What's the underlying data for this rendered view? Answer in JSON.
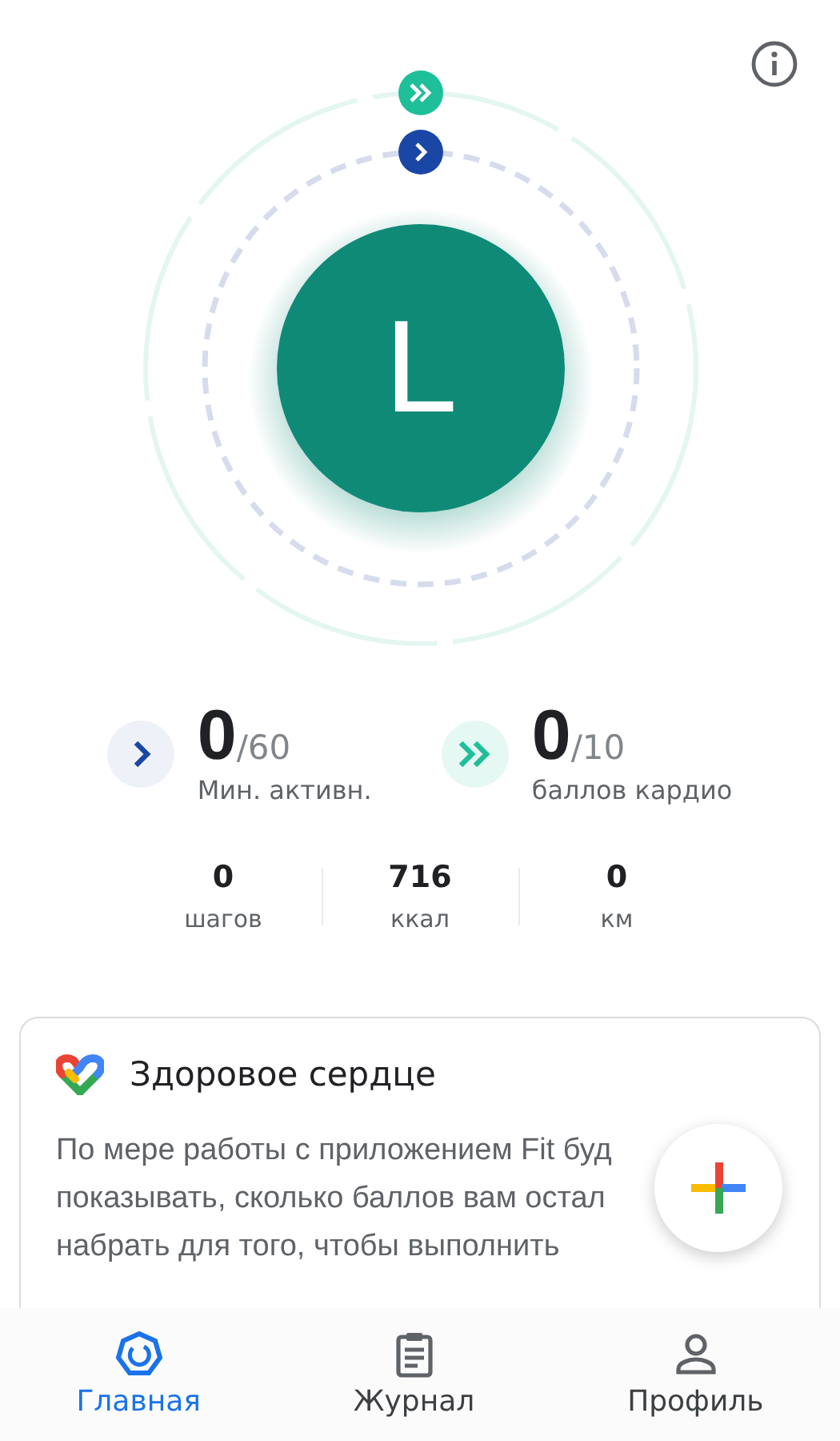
{
  "avatar": {
    "letter": "L"
  },
  "goals": [
    {
      "kind": "move",
      "value": "0",
      "target": "/60",
      "label": "Мин. активн."
    },
    {
      "kind": "heart",
      "value": "0",
      "target": "/10",
      "label": "баллов кардио"
    }
  ],
  "metrics": [
    {
      "value": "0",
      "label": "шагов"
    },
    {
      "value": "716",
      "label": "ккал"
    },
    {
      "value": "0",
      "label": "км"
    }
  ],
  "card": {
    "title": "Здоровое сердце",
    "lines": [
      "По мере работы с приложением Fit буд",
      "показывать, сколько баллов вам остал",
      "набрать для того, чтобы выполнить"
    ]
  },
  "nav": [
    {
      "kind": "home",
      "label": "Главная",
      "selected": true
    },
    {
      "kind": "journal",
      "label": "Журнал",
      "selected": false
    },
    {
      "kind": "profile",
      "label": "Профиль",
      "selected": false
    }
  ]
}
